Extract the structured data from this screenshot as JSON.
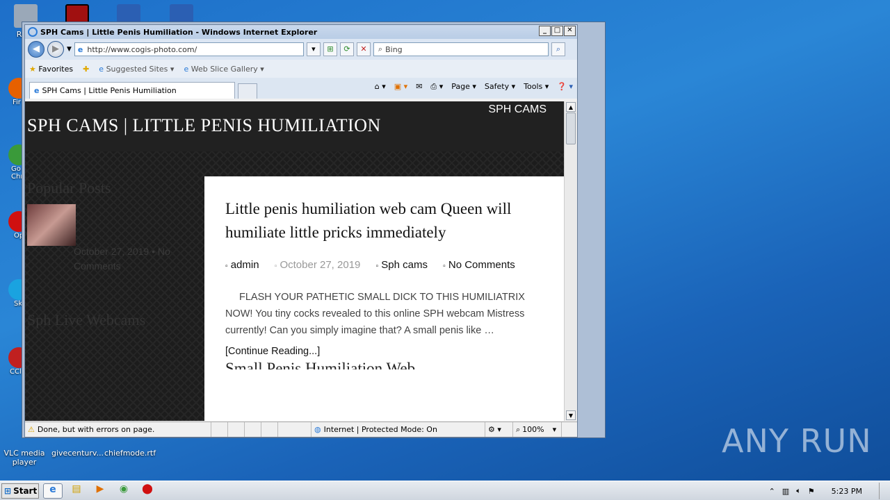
{
  "desktop": {
    "icons_top": [
      {
        "label": "Recy",
        "color": "#9aa8b8"
      },
      {
        "label": "",
        "color": "#a01010"
      },
      {
        "label": "",
        "color": "#2b5fb3"
      },
      {
        "label": "",
        "color": "#2b5fb3"
      }
    ],
    "left_clipped": [
      "Fir",
      "Go Chr",
      "Op",
      "Sk",
      "CCl"
    ],
    "icons_bottom": [
      "VLC media player",
      "givecenturv...",
      "chiefmode.rtf"
    ],
    "watermark": "ANY RUN"
  },
  "browser": {
    "title": "SPH Cams | Little Penis Humiliation - Windows Internet Explorer",
    "url": "http://www.cogis-photo.com/",
    "search_placeholder": "Bing",
    "favorites": {
      "favorites_label": "Favorites",
      "suggested_label": "Suggested Sites",
      "webslice_label": "Web Slice Gallery"
    },
    "tab_title": "SPH Cams | Little Penis Humiliation",
    "commands": [
      "Page",
      "Safety",
      "Tools"
    ],
    "status": {
      "text": "Done, but with errors on page.",
      "zone": "Internet | Protected Mode: On",
      "zoom": "100%"
    }
  },
  "site": {
    "nav_item": "SPH CAMS",
    "title": "SPH CAMS | LITTLE PENIS HUMILIATION",
    "sidebar": {
      "popular_heading": "Popular Posts",
      "popular_date": "October 27, 2019",
      "popular_comments": "No Comments",
      "live_heading": "Sph Live Webcams"
    },
    "post": {
      "title": "Little penis humiliation web cam Queen will humiliate little pricks immediately",
      "author": "admin",
      "date": "October 27, 2019",
      "category": "Sph cams",
      "comments": "No Comments",
      "excerpt": "FLASH YOUR PATHETIC SMALL DICK TO THIS HUMILIATRIX NOW! You tiny cocks revealed to this online SPH webcam Mistress currently! Can you simply imagine that? A small penis like …",
      "read_more": "[Continue Reading...]",
      "next_title": "Small Penis Humiliation Web"
    }
  },
  "taskbar": {
    "start_label": "Start",
    "clock": "5:23 PM"
  }
}
